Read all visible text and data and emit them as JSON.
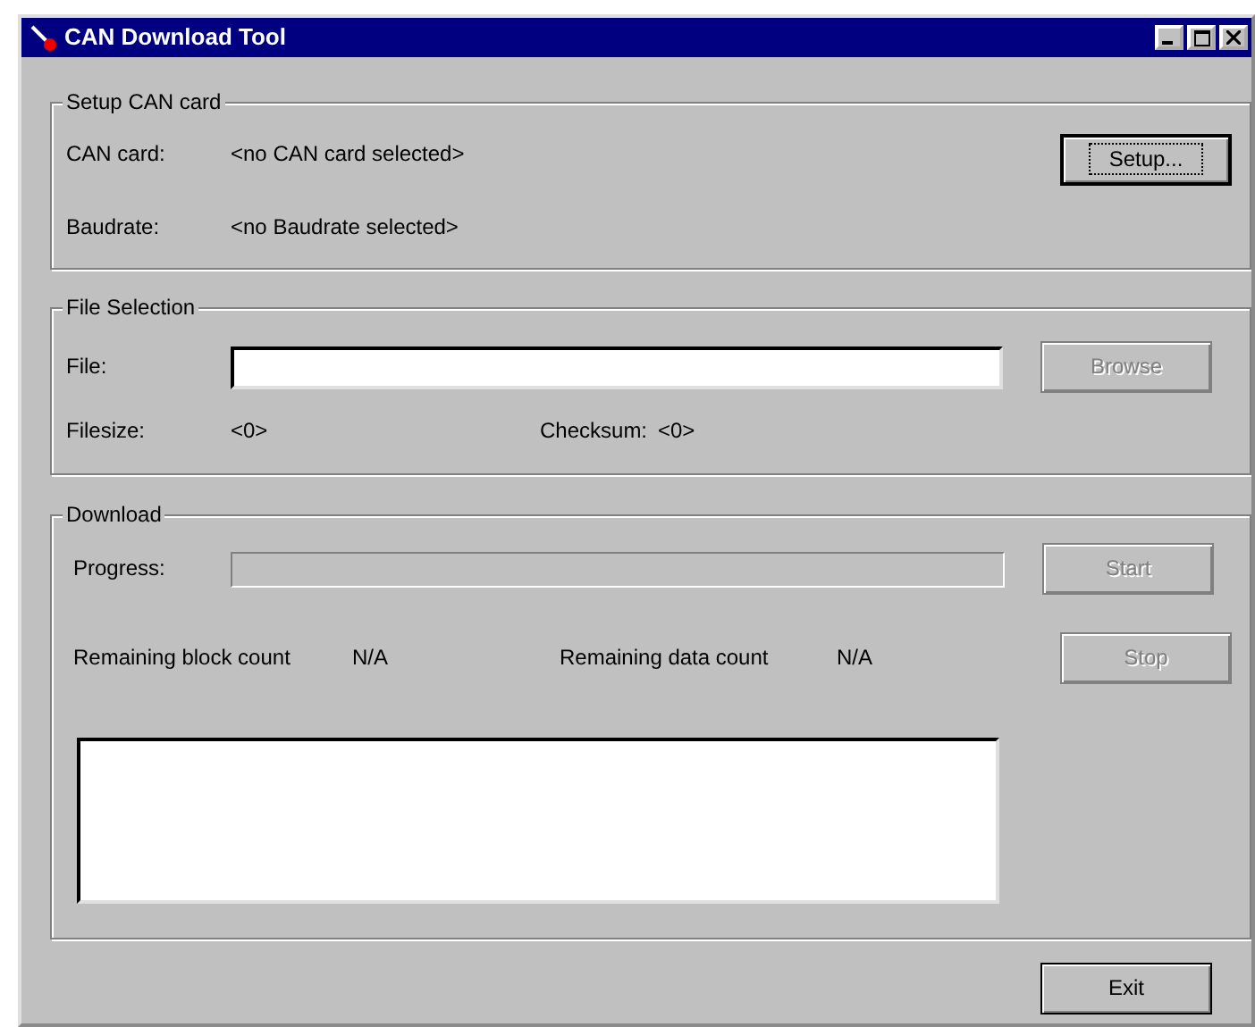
{
  "window": {
    "title": "CAN Download Tool"
  },
  "setup_group": {
    "title": "Setup CAN card",
    "rows": [
      {
        "label": "CAN card:",
        "value": "<no CAN card selected>"
      },
      {
        "label": "Baudrate:",
        "value": "<no Baudrate selected>"
      }
    ],
    "button": {
      "label": "Setup...",
      "disabled": false,
      "focused": true
    }
  },
  "file_group": {
    "title": "File Selection",
    "file_label": "File:",
    "button": {
      "label": "Browse",
      "disabled": true,
      "focused": false
    },
    "filesize_label": "Filesize:",
    "filesize_value": "<0>",
    "checksum_label": "Checksum:",
    "checksum_value": "<0>"
  },
  "download_group": {
    "title": "Download",
    "progress_label": "Progress:",
    "progress": {
      "level": 0
    },
    "start_button": {
      "label": "Start",
      "disabled": true,
      "focused": false
    },
    "block_label": "Remaining block count",
    "block_value": "N/A",
    "data_label": "Remaining data count",
    "data_value": "N/A",
    "stop_button": {
      "label": "Stop",
      "disabled": true,
      "focused": false
    }
  },
  "exit_button": {
    "label": "Exit",
    "disabled": false,
    "focused": false
  }
}
